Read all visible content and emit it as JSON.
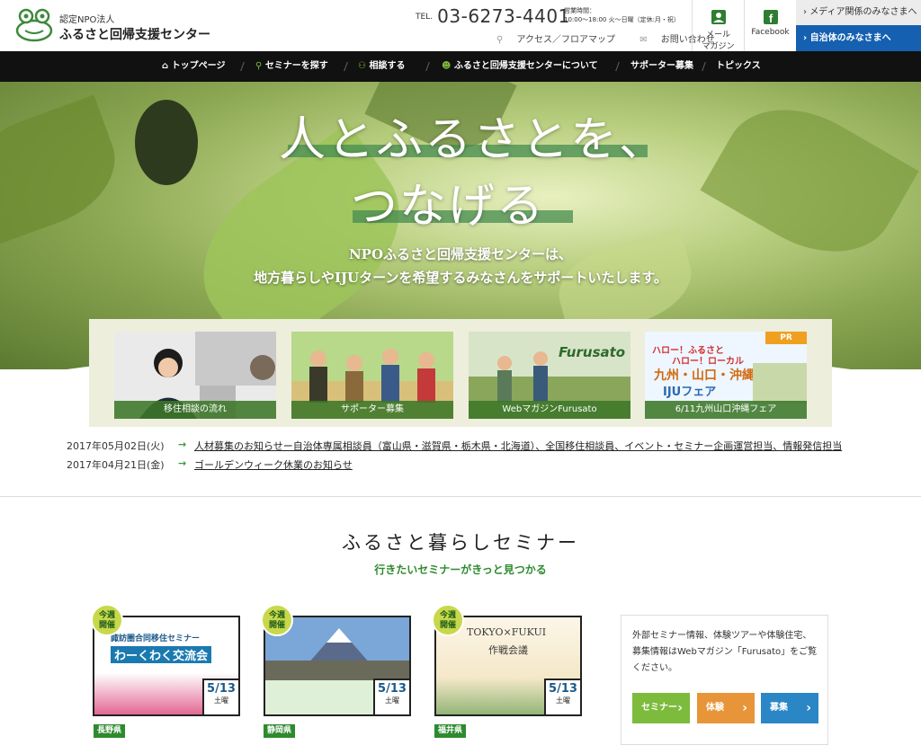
{
  "header": {
    "logo_sub": "認定NPO法人",
    "logo_name": "ふるさと回帰支援センター",
    "tel_label": "TEL.",
    "tel_number": "03-6273-4401",
    "hours_label": "営業時間：",
    "hours_value": "10:00〜18:00 火〜日曜（定休:月・祝）",
    "access_link": "アクセス／フロアマップ",
    "contact_link": "お問い合わせ",
    "mail_btn_line1": "メール",
    "mail_btn_line2": "マガジン",
    "facebook_btn": "Facebook",
    "media_link": "メディア関係のみなさまへ",
    "jichitai_link": "自治体のみなさまへ"
  },
  "nav": {
    "items": [
      "トップページ",
      "セミナーを探す",
      "相談する",
      "ふるさと回帰支援センターについて",
      "サポーター募集",
      "トピックス"
    ]
  },
  "hero": {
    "title_line1": "人とふるさとを、",
    "title_line2": "つなげる",
    "desc_line1": "NPOふるさと回帰支援センターは、",
    "desc_line2": "地方暮らしやIJUターンを希望するみなさんをサポートいたします。"
  },
  "banners": [
    {
      "caption": "移住相談の流れ"
    },
    {
      "caption": "サポーター募集"
    },
    {
      "caption": "WebマガジンFurusato",
      "logo": "Furusato"
    },
    {
      "caption": "6/11九州山口沖縄フェア",
      "pr": "PR",
      "line1": "ハロー！ふるさと",
      "line2": "ハロー！ローカル",
      "line3": "九州・山口・沖縄",
      "line4": "IJUフェア"
    }
  ],
  "news": [
    {
      "date": "2017年05月02日(火)",
      "title": "人材募集のお知らせー自治体専属相談員（富山県・滋賀県・栃木県・北海道）、全国移住相談員、イベント・セミナー企画運営担当、情報発信担当"
    },
    {
      "date": "2017年04月21日(金)",
      "title": "ゴールデンウィーク休業のお知らせ"
    }
  ],
  "seminar": {
    "title": "ふるさと暮らしセミナー",
    "subtitle": "行きたいセミナーがきっと見つかる",
    "cards": [
      {
        "badge1": "今週",
        "badge2": "開催",
        "date": "5/13",
        "weekday": "土曜",
        "pref": "長野県",
        "poster1": "諏訪圏合同移住セミナー",
        "poster2": "わーくわく交流会"
      },
      {
        "badge1": "今週",
        "badge2": "開催",
        "date": "5/13",
        "weekday": "土曜",
        "pref": "静岡県"
      },
      {
        "badge1": "今週",
        "badge2": "開催",
        "date": "5/13",
        "weekday": "土曜",
        "pref": "福井県",
        "poster1": "TOKYO×FUKUI",
        "poster2": "作戦会議"
      }
    ],
    "side_text": "外部セミナー情報、体験ツアーや体験住宅、募集情報はWebマガジン「Furusato」をご覧ください。",
    "side_buttons": [
      {
        "label": "セミナー",
        "color": "#7dbb3c"
      },
      {
        "label": "体験",
        "color": "#e8953a"
      },
      {
        "label": "募集",
        "color": "#2b86c6"
      }
    ]
  }
}
